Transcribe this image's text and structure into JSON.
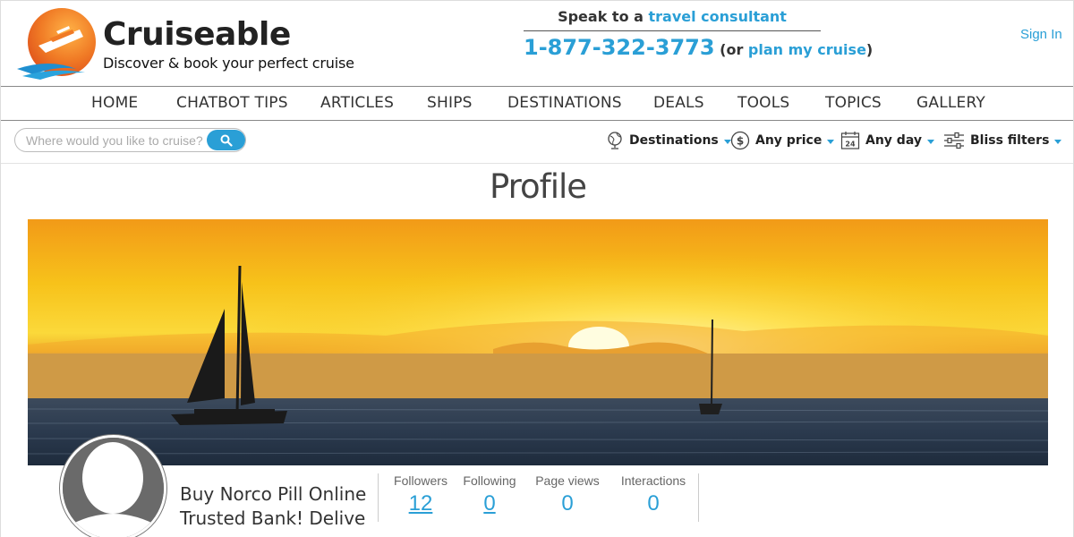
{
  "header": {
    "brand_name": "Cruiseable",
    "brand_tagline": "Discover & book your perfect cruise",
    "speak_prefix": "Speak to a ",
    "speak_link": "travel consultant",
    "phone": "1-877-322-3773",
    "or_open": " (or ",
    "plan_link": "plan my cruise",
    "or_close": ")",
    "signin": "Sign In"
  },
  "nav": {
    "items": [
      "HOME",
      "CHATBOT TIPS",
      "ARTICLES",
      "SHIPS",
      "DESTINATIONS",
      "DEALS",
      "TOOLS",
      "TOPICS",
      "GALLERY"
    ]
  },
  "search": {
    "placeholder": "Where would you like to cruise?"
  },
  "filters": {
    "destinations": "Destinations",
    "price": "Any price",
    "day": "Any day",
    "calendar_day": "24",
    "bliss": "Bliss filters"
  },
  "profile": {
    "title": "Profile",
    "name": "Buy Norco Pill Online Trusted Bank! Delive",
    "stats": [
      {
        "label": "Followers",
        "value": "12"
      },
      {
        "label": "Following",
        "value": "0"
      },
      {
        "label": "Page views",
        "value": "0"
      },
      {
        "label": "Interactions",
        "value": "0"
      }
    ]
  },
  "colors": {
    "accent": "#2a9fd6",
    "text": "#333333"
  }
}
